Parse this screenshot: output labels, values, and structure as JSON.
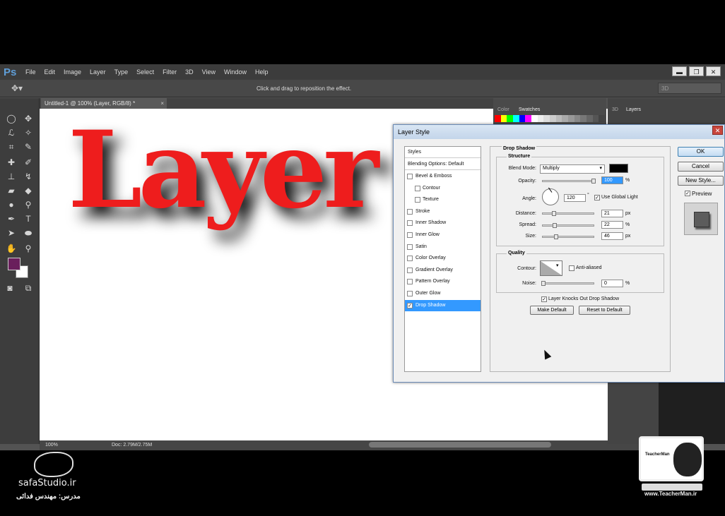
{
  "app": {
    "logo": "Ps",
    "menu": [
      "File",
      "Edit",
      "Image",
      "Layer",
      "Type",
      "Select",
      "Filter",
      "3D",
      "View",
      "Window",
      "Help"
    ],
    "window_controls": [
      "▬",
      "❐",
      "✕"
    ]
  },
  "options_bar": {
    "hint": "Click and drag to reposition the effect.",
    "workspace": "3D"
  },
  "document": {
    "tab_title": "Untitled-1 @ 100% (Layer, RGB/8) *",
    "tab_close": "×",
    "canvas_text": "Layer",
    "text_color": "#ee1d1d"
  },
  "status_bar": {
    "zoom": "100%",
    "doc_size": "Doc: 2.79M/2.75M"
  },
  "panels": {
    "color_tab": "Color",
    "swatches_tab": "Swatches",
    "tab_3d": "3D",
    "layers_tab": "Layers",
    "swatch_colors": [
      "#ff0000",
      "#ffff00",
      "#00ff00",
      "#00ffff",
      "#0000ff",
      "#ff00ff",
      "#ffffff",
      "#eeeeee",
      "#dddddd",
      "#cccccc",
      "#bbbbbb",
      "#aaaaaa",
      "#999999",
      "#888888",
      "#777777",
      "#666666",
      "#555555",
      "#444444"
    ]
  },
  "dialog": {
    "title": "Layer Style",
    "close": "✕",
    "styles": {
      "header": "Styles",
      "blending": "Blending Options: Default",
      "items": [
        {
          "label": "Bevel & Emboss",
          "checked": false,
          "sub": false
        },
        {
          "label": "Contour",
          "checked": false,
          "sub": true
        },
        {
          "label": "Texture",
          "checked": false,
          "sub": true
        },
        {
          "label": "Stroke",
          "checked": false,
          "sub": false
        },
        {
          "label": "Inner Shadow",
          "checked": false,
          "sub": false
        },
        {
          "label": "Inner Glow",
          "checked": false,
          "sub": false
        },
        {
          "label": "Satin",
          "checked": false,
          "sub": false
        },
        {
          "label": "Color Overlay",
          "checked": false,
          "sub": false
        },
        {
          "label": "Gradient Overlay",
          "checked": false,
          "sub": false
        },
        {
          "label": "Pattern Overlay",
          "checked": false,
          "sub": false
        },
        {
          "label": "Outer Glow",
          "checked": false,
          "sub": false
        },
        {
          "label": "Drop Shadow",
          "checked": true,
          "sub": false,
          "selected": true
        }
      ]
    },
    "drop_shadow": {
      "title": "Drop Shadow",
      "structure": {
        "title": "Structure",
        "blend_mode_label": "Blend Mode:",
        "blend_mode": "Multiply",
        "shadow_color": "#000000",
        "opacity_label": "Opacity:",
        "opacity": "100",
        "opacity_unit": "%",
        "angle_label": "Angle:",
        "angle": "120",
        "angle_unit": "°",
        "use_global_light": "Use Global Light",
        "distance_label": "Distance:",
        "distance": "21",
        "distance_unit": "px",
        "spread_label": "Spread:",
        "spread": "22",
        "spread_unit": "%",
        "size_label": "Size:",
        "size": "46",
        "size_unit": "px"
      },
      "quality": {
        "title": "Quality",
        "contour_label": "Contour:",
        "anti_aliased": "Anti-aliased",
        "noise_label": "Noise:",
        "noise": "0",
        "noise_unit": "%"
      },
      "layer_knocks_out": "Layer Knocks Out Drop Shadow",
      "make_default": "Make Default",
      "reset_default": "Reset to Default"
    },
    "buttons": {
      "ok": "OK",
      "cancel": "Cancel",
      "new_style": "New Style...",
      "preview": "Preview"
    }
  },
  "watermarks": {
    "left_site": "safaStudio.ir",
    "left_teacher": "مدرس: مهندس فدائی",
    "right_title": "TeacherMan",
    "right_site": "www.TeacherMan.ir"
  }
}
